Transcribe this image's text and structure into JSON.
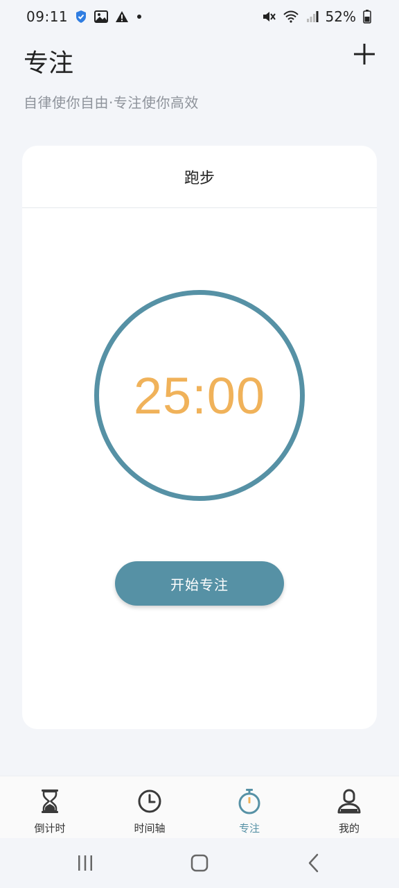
{
  "status_bar": {
    "time": "09:11",
    "battery": "52%",
    "icons": [
      "shield-check-icon",
      "image-icon",
      "warning-icon",
      "dot-icon",
      "mute-icon",
      "wifi-icon",
      "signal-icon",
      "battery-icon"
    ]
  },
  "header": {
    "title": "专注",
    "subtitle": "自律使你自由·专注使你高效",
    "add_icon": "plus-icon"
  },
  "card": {
    "task_name": "跑步",
    "timer": "25:00",
    "start_label": "开始专注"
  },
  "bottom_nav": {
    "items": [
      {
        "label": "倒计时",
        "icon": "hourglass-icon",
        "active": false
      },
      {
        "label": "时间轴",
        "icon": "clock-icon",
        "active": false
      },
      {
        "label": "专注",
        "icon": "stopwatch-icon",
        "active": true
      },
      {
        "label": "我的",
        "icon": "user-icon",
        "active": false
      }
    ]
  },
  "colors": {
    "accent": "#5691a5",
    "timer": "#f0b25a",
    "background": "#f3f5f9",
    "card": "#ffffff"
  },
  "system_nav": {
    "icons": [
      "recent-apps-icon",
      "home-icon",
      "back-icon"
    ]
  }
}
